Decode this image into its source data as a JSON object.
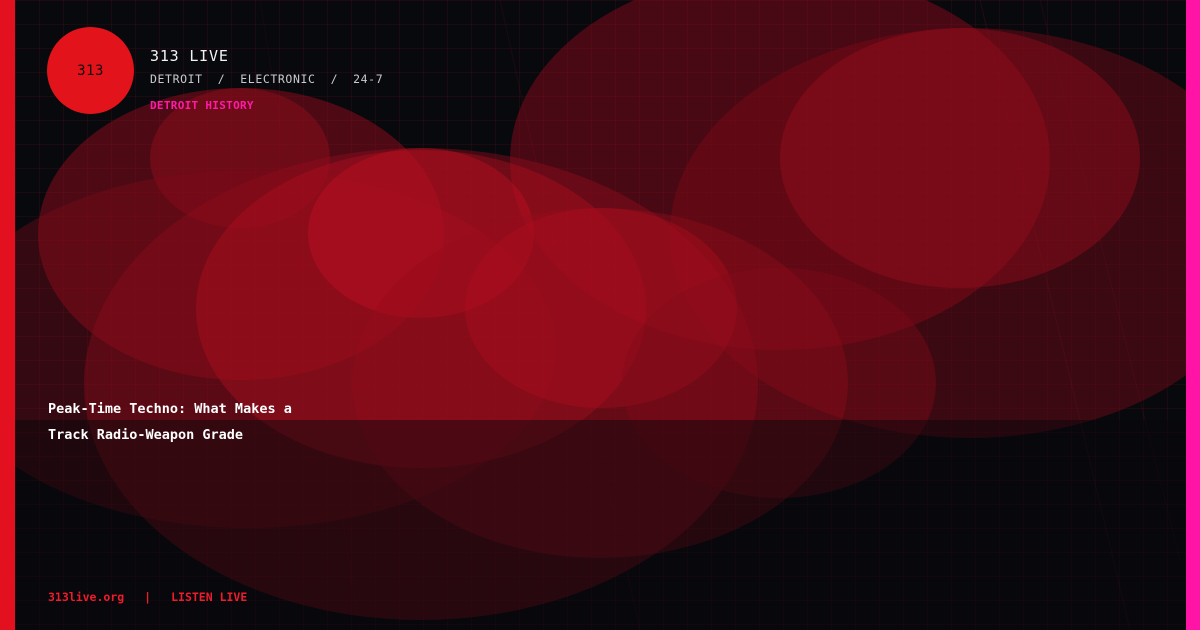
{
  "logo": {
    "text": "313"
  },
  "brand": {
    "name": "313 LIVE",
    "tagline": "DETROIT  /  ELECTRONIC  /  24-7"
  },
  "category": "DETROIT HISTORY",
  "headline": {
    "line1": "Peak-Time Techno: What Makes a",
    "line2": "Track Radio-Weapon Grade"
  },
  "footer": {
    "site": "313live.org",
    "separator": "|",
    "cta": "LISTEN LIVE"
  },
  "colors": {
    "background": "#08090d",
    "accent_red": "#e3101f",
    "accent_pink": "#ff14a6",
    "text": "#ffffff"
  }
}
